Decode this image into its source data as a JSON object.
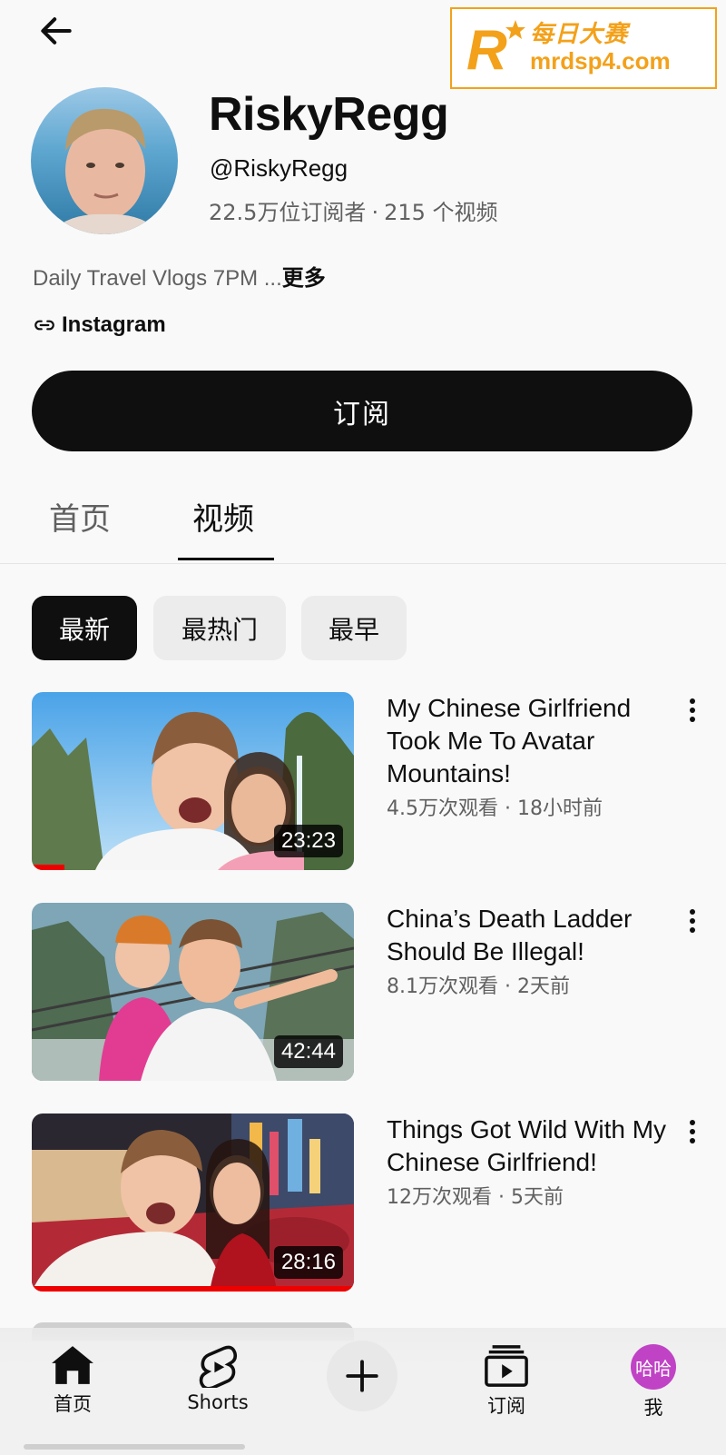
{
  "watermark": {
    "cn_text": "每日大赛",
    "url": "mrdsp4.com",
    "logo_letter": "R",
    "color": "#f3a11a"
  },
  "channel": {
    "name": "RiskyRegg",
    "handle": "@RiskyRegg",
    "subscribers": "22.5万位订阅者",
    "separator": "·",
    "video_count": "215 个视频",
    "description": "Daily Travel Vlogs 7PM ...",
    "more_label": "更多",
    "link_label": "Instagram",
    "subscribe_label": "订阅"
  },
  "tabs": [
    {
      "label": "首页",
      "selected": false
    },
    {
      "label": "视频",
      "selected": true
    }
  ],
  "chips": [
    {
      "label": "最新",
      "selected": true
    },
    {
      "label": "最热门",
      "selected": false
    },
    {
      "label": "最早",
      "selected": false
    }
  ],
  "videos": [
    {
      "title": "My Chinese Girlfriend Took Me To Avatar Mountains!",
      "meta": "4.5万次观看 · 18小时前",
      "duration": "23:23",
      "watched_fraction": 0.1
    },
    {
      "title": "China’s Death Ladder Should Be Illegal!",
      "meta": "8.1万次观看 · 2天前",
      "duration": "42:44",
      "watched_fraction": 0
    },
    {
      "title": "Things Got Wild With My Chinese Girlfriend!",
      "meta": "12万次观看 · 5天前",
      "duration": "28:16",
      "watched_fraction": 1.0
    }
  ],
  "bottom_nav": {
    "home": "首页",
    "shorts": "Shorts",
    "subscriptions": "订阅",
    "me": "我",
    "me_avatar_text": "哈哈",
    "me_avatar_color": "#c043c6"
  },
  "icons": [
    "back-arrow-icon",
    "link-icon",
    "kebab-menu-icon",
    "home-icon",
    "shorts-icon",
    "plus-icon",
    "subscriptions-icon"
  ]
}
